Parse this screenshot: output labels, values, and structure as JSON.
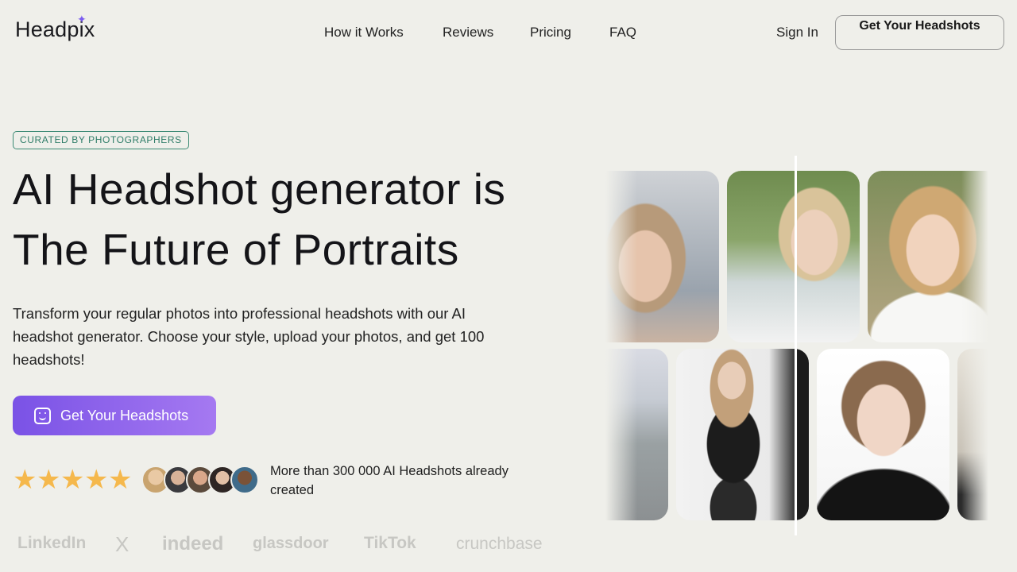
{
  "header": {
    "logo": "Headpix",
    "nav": [
      {
        "label": "How it Works"
      },
      {
        "label": "Reviews"
      },
      {
        "label": "Pricing"
      },
      {
        "label": "FAQ"
      }
    ],
    "sign_in": "Sign In",
    "cta": "Get Your Headshots"
  },
  "hero": {
    "badge": "CURATED BY PHOTOGRAPHERS",
    "headline_line1": "AI Headshot generator is",
    "headline_line2": "The Future of Portraits",
    "subtext": "Transform your regular photos into professional headshots with our AI headshot generator. Choose your style, upload your photos, and get 100 headshots!",
    "cta": "Get Your Headshots",
    "rating_stars": 5,
    "social_proof": "More than 300 000 AI Headshots already created"
  },
  "brands": [
    "LinkedIn",
    "X",
    "indeed",
    "glassdoor",
    "TikTok",
    "crunchbase"
  ],
  "colors": {
    "background": "#efefea",
    "accent": "#7a52e6",
    "accent_light": "#a579f1",
    "badge": "#2f7d68",
    "star": "#f5b84c"
  }
}
